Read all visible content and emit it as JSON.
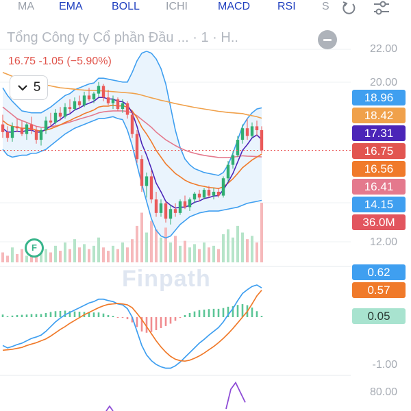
{
  "toolbar": {
    "tabs": [
      {
        "label": "MA",
        "active": false
      },
      {
        "label": "EMA",
        "active": true
      },
      {
        "label": "BOLL",
        "active": true
      },
      {
        "label": "ICHI",
        "active": false
      },
      {
        "label": "MACD",
        "active": true
      },
      {
        "label": "RSI",
        "active": true
      },
      {
        "label": "S",
        "active": false
      }
    ],
    "icons": [
      "reset-icon",
      "settings-sliders-icon"
    ]
  },
  "header": {
    "title": "Tổng Công ty Cổ phần Đầu ...  · 1 · H..",
    "quote": "16.75  -1.05 (−5.90%)",
    "period": "5"
  },
  "price_axis": {
    "labels": [
      "22.00",
      "20.00",
      "12.00"
    ]
  },
  "price_badges": [
    {
      "label": "18.96",
      "color": "#3f9ff0"
    },
    {
      "label": "18.42",
      "color": "#f0a14b"
    },
    {
      "label": "17.31",
      "color": "#4b25b8"
    },
    {
      "label": "16.75",
      "color": "#e25550"
    },
    {
      "label": "16.56",
      "color": "#f07a2a"
    },
    {
      "label": "16.41",
      "color": "#e4798d"
    },
    {
      "label": "14.15",
      "color": "#3f9ff0"
    },
    {
      "label": "36.0M",
      "color": "#e2555e"
    }
  ],
  "macd_axis": {
    "labels": [
      "-1.00"
    ]
  },
  "macd_badges": [
    {
      "label": "0.62",
      "color": "#3f9ff0"
    },
    {
      "label": "0.57",
      "color": "#f07a2a"
    },
    {
      "label": "0.05",
      "color": "#a8e3cf",
      "text": "#2a3a33"
    }
  ],
  "rsi_axis": {
    "labels": [
      "80.00"
    ]
  },
  "watermark": "Finpath",
  "logo_text": "F",
  "colors": {
    "up": "#2fae72",
    "down": "#ea5a5a",
    "boll": "#3f9ff0",
    "ema_slow": "#f0a14b",
    "ema_mid": "#4b25b8",
    "ema_fast": "#f07a2a",
    "ema_pink": "#e4798d",
    "macd_line": "#3f9ff0",
    "signal_line": "#f07a2a",
    "rsi": "#8e4cd6"
  },
  "chart_data": {
    "type": "line",
    "candles": [
      {
        "o": 18.1,
        "h": 18.6,
        "l": 17.4,
        "c": 17.7
      },
      {
        "o": 17.7,
        "h": 18.0,
        "l": 17.2,
        "c": 17.4
      },
      {
        "o": 17.4,
        "h": 18.2,
        "l": 17.2,
        "c": 18.0
      },
      {
        "o": 18.0,
        "h": 18.4,
        "l": 17.7,
        "c": 17.9
      },
      {
        "o": 17.9,
        "h": 18.3,
        "l": 17.5,
        "c": 17.6
      },
      {
        "o": 17.6,
        "h": 18.2,
        "l": 17.3,
        "c": 18.1
      },
      {
        "o": 18.1,
        "h": 18.5,
        "l": 17.6,
        "c": 17.8
      },
      {
        "o": 17.8,
        "h": 18.0,
        "l": 17.1,
        "c": 17.3
      },
      {
        "o": 17.3,
        "h": 17.9,
        "l": 17.0,
        "c": 17.8
      },
      {
        "o": 17.8,
        "h": 18.5,
        "l": 17.6,
        "c": 18.3
      },
      {
        "o": 18.3,
        "h": 18.7,
        "l": 18.0,
        "c": 18.2
      },
      {
        "o": 18.2,
        "h": 18.9,
        "l": 18.1,
        "c": 18.7
      },
      {
        "o": 18.7,
        "h": 19.0,
        "l": 18.3,
        "c": 18.5
      },
      {
        "o": 18.5,
        "h": 19.2,
        "l": 18.4,
        "c": 19.0
      },
      {
        "o": 19.0,
        "h": 19.4,
        "l": 18.7,
        "c": 18.9
      },
      {
        "o": 18.9,
        "h": 19.5,
        "l": 18.8,
        "c": 19.3
      },
      {
        "o": 19.3,
        "h": 19.6,
        "l": 18.9,
        "c": 19.1
      },
      {
        "o": 19.1,
        "h": 19.8,
        "l": 19.0,
        "c": 19.6
      },
      {
        "o": 19.6,
        "h": 20.0,
        "l": 19.3,
        "c": 19.4
      },
      {
        "o": 19.4,
        "h": 19.8,
        "l": 19.2,
        "c": 19.7
      },
      {
        "o": 19.7,
        "h": 20.3,
        "l": 19.5,
        "c": 20.1
      },
      {
        "o": 20.1,
        "h": 20.2,
        "l": 19.3,
        "c": 19.5
      },
      {
        "o": 19.5,
        "h": 19.9,
        "l": 19.1,
        "c": 19.2
      },
      {
        "o": 19.2,
        "h": 19.6,
        "l": 18.9,
        "c": 19.4
      },
      {
        "o": 19.4,
        "h": 19.5,
        "l": 18.8,
        "c": 18.9
      },
      {
        "o": 18.9,
        "h": 19.4,
        "l": 18.7,
        "c": 19.2
      },
      {
        "o": 19.2,
        "h": 19.3,
        "l": 18.4,
        "c": 18.6
      },
      {
        "o": 18.6,
        "h": 18.8,
        "l": 17.4,
        "c": 17.6
      },
      {
        "o": 17.6,
        "h": 17.8,
        "l": 16.1,
        "c": 16.3
      },
      {
        "o": 16.3,
        "h": 16.5,
        "l": 14.6,
        "c": 14.9
      },
      {
        "o": 14.9,
        "h": 15.6,
        "l": 14.3,
        "c": 15.4
      },
      {
        "o": 15.4,
        "h": 15.7,
        "l": 14.0,
        "c": 14.2
      },
      {
        "o": 14.2,
        "h": 14.6,
        "l": 13.3,
        "c": 13.5
      },
      {
        "o": 13.5,
        "h": 14.2,
        "l": 13.3,
        "c": 14.0
      },
      {
        "o": 14.0,
        "h": 14.1,
        "l": 13.0,
        "c": 13.2
      },
      {
        "o": 13.2,
        "h": 13.9,
        "l": 12.9,
        "c": 13.7
      },
      {
        "o": 13.7,
        "h": 14.0,
        "l": 13.3,
        "c": 13.5
      },
      {
        "o": 13.5,
        "h": 14.2,
        "l": 13.4,
        "c": 14.1
      },
      {
        "o": 14.1,
        "h": 14.4,
        "l": 13.7,
        "c": 13.8
      },
      {
        "o": 13.8,
        "h": 14.3,
        "l": 13.6,
        "c": 14.2
      },
      {
        "o": 14.2,
        "h": 14.6,
        "l": 14.0,
        "c": 14.5
      },
      {
        "o": 14.5,
        "h": 14.7,
        "l": 14.1,
        "c": 14.3
      },
      {
        "o": 14.3,
        "h": 14.8,
        "l": 14.2,
        "c": 14.7
      },
      {
        "o": 14.7,
        "h": 14.9,
        "l": 14.3,
        "c": 14.4
      },
      {
        "o": 14.4,
        "h": 14.8,
        "l": 14.2,
        "c": 14.6
      },
      {
        "o": 14.6,
        "h": 14.8,
        "l": 14.3,
        "c": 14.4
      },
      {
        "o": 14.4,
        "h": 15.4,
        "l": 14.3,
        "c": 15.3
      },
      {
        "o": 15.3,
        "h": 16.2,
        "l": 15.1,
        "c": 16.0
      },
      {
        "o": 16.0,
        "h": 16.7,
        "l": 15.8,
        "c": 16.5
      },
      {
        "o": 16.5,
        "h": 17.5,
        "l": 16.4,
        "c": 17.3
      },
      {
        "o": 17.3,
        "h": 18.1,
        "l": 17.1,
        "c": 17.9
      },
      {
        "o": 17.9,
        "h": 18.4,
        "l": 17.3,
        "c": 17.5
      },
      {
        "o": 17.5,
        "h": 18.2,
        "l": 17.4,
        "c": 18.0
      },
      {
        "o": 18.0,
        "h": 18.3,
        "l": 17.5,
        "c": 17.8
      },
      {
        "o": 17.8,
        "h": 18.0,
        "l": 16.6,
        "c": 16.75
      }
    ],
    "volume_scale": 36.0,
    "volumes": [
      6,
      4,
      9,
      5,
      8,
      4,
      7,
      6,
      11,
      8,
      6,
      10,
      7,
      12,
      8,
      14,
      9,
      11,
      8,
      10,
      15,
      9,
      7,
      10,
      8,
      12,
      9,
      14,
      22,
      30,
      18,
      25,
      20,
      15,
      21,
      12,
      16,
      10,
      13,
      9,
      11,
      8,
      12,
      9,
      10,
      8,
      17,
      20,
      15,
      22,
      18,
      14,
      16,
      12,
      36
    ],
    "ema_slow": [
      20.8,
      20.7,
      20.6,
      20.5,
      20.45,
      20.4,
      20.3,
      20.25,
      20.2,
      20.15,
      20.1,
      20.05,
      20.0,
      19.98,
      19.95,
      19.93,
      19.9,
      19.88,
      19.87,
      19.86,
      19.85,
      19.84,
      19.82,
      19.8,
      19.78,
      19.76,
      19.74,
      19.72,
      19.68,
      19.62,
      19.55,
      19.48,
      19.42,
      19.35,
      19.3,
      19.24,
      19.18,
      19.13,
      19.08,
      19.03,
      18.98,
      18.94,
      18.9,
      18.86,
      18.82,
      18.78,
      18.75,
      18.72,
      18.7,
      18.68,
      18.66,
      18.6,
      18.55,
      18.5,
      18.42
    ],
    "ema_pink": [
      19.0,
      18.8,
      18.6,
      18.4,
      18.3,
      18.2,
      18.1,
      18.0,
      17.95,
      17.95,
      17.98,
      18.02,
      18.08,
      18.15,
      18.22,
      18.3,
      18.38,
      18.45,
      18.52,
      18.6,
      18.7,
      18.75,
      18.78,
      18.8,
      18.8,
      18.8,
      18.78,
      18.7,
      18.55,
      18.35,
      18.15,
      17.95,
      17.7,
      17.5,
      17.3,
      17.15,
      17.0,
      16.87,
      16.76,
      16.67,
      16.6,
      16.54,
      16.49,
      16.45,
      16.42,
      16.38,
      16.37,
      16.38,
      16.4,
      16.43,
      16.47,
      16.45,
      16.44,
      16.43,
      16.41
    ],
    "ema_fast": [
      18.3,
      18.1,
      18.0,
      17.95,
      17.9,
      17.9,
      17.88,
      17.8,
      17.75,
      17.8,
      17.87,
      17.97,
      18.07,
      18.2,
      18.3,
      18.43,
      18.53,
      18.66,
      18.75,
      18.85,
      19.0,
      19.05,
      19.05,
      19.1,
      19.05,
      19.07,
      19.0,
      18.8,
      18.45,
      17.95,
      17.6,
      17.2,
      16.75,
      16.4,
      16.05,
      15.8,
      15.55,
      15.38,
      15.2,
      15.08,
      15.0,
      14.92,
      14.88,
      14.82,
      14.8,
      14.77,
      14.85,
      15.05,
      15.27,
      15.55,
      15.85,
      16.05,
      16.25,
      16.4,
      16.56
    ],
    "ema_mid": [
      17.9,
      17.7,
      17.7,
      17.75,
      17.7,
      17.8,
      17.8,
      17.7,
      17.7,
      17.85,
      18.0,
      18.2,
      18.35,
      18.55,
      18.65,
      18.85,
      18.95,
      19.1,
      19.2,
      19.3,
      19.5,
      19.5,
      19.42,
      19.42,
      19.3,
      19.28,
      19.1,
      18.7,
      18.0,
      17.1,
      16.5,
      15.8,
      15.05,
      14.6,
      14.1,
      13.9,
      13.75,
      13.8,
      13.8,
      13.9,
      14.05,
      14.12,
      14.25,
      14.3,
      14.38,
      14.4,
      14.7,
      15.1,
      15.55,
      16.15,
      16.75,
      17.05,
      17.4,
      17.55,
      17.31
    ],
    "boll_upper": [
      20.0,
      19.6,
      19.3,
      19.05,
      18.8,
      18.75,
      18.7,
      18.7,
      18.7,
      18.85,
      19.0,
      19.2,
      19.4,
      19.6,
      19.7,
      19.9,
      20.0,
      20.1,
      20.2,
      20.25,
      20.5,
      20.5,
      20.45,
      20.4,
      20.35,
      20.3,
      20.3,
      20.8,
      21.4,
      21.8,
      21.9,
      21.8,
      21.5,
      21.0,
      20.2,
      19.0,
      17.8,
      16.9,
      16.3,
      16.0,
      15.8,
      15.7,
      15.6,
      15.55,
      15.5,
      15.45,
      15.6,
      16.0,
      16.6,
      17.3,
      18.0,
      18.4,
      18.7,
      18.9,
      18.96
    ],
    "boll_lower": [
      16.8,
      16.5,
      16.4,
      16.45,
      16.5,
      16.5,
      16.6,
      16.6,
      16.7,
      16.8,
      17.0,
      17.2,
      17.4,
      17.6,
      17.75,
      17.9,
      18.0,
      18.1,
      18.2,
      18.3,
      18.4,
      18.4,
      18.45,
      18.5,
      18.4,
      18.35,
      17.8,
      17.0,
      16.0,
      15.0,
      14.1,
      13.2,
      12.6,
      12.3,
      12.2,
      12.3,
      12.6,
      12.9,
      13.1,
      13.3,
      13.4,
      13.5,
      13.55,
      13.6,
      13.6,
      13.6,
      13.65,
      13.7,
      13.75,
      13.8,
      13.9,
      14.0,
      14.05,
      14.1,
      14.15
    ],
    "macd": [
      -0.6,
      -0.65,
      -0.62,
      -0.58,
      -0.55,
      -0.5,
      -0.45,
      -0.42,
      -0.38,
      -0.3,
      -0.2,
      -0.1,
      -0.02,
      0.05,
      0.1,
      0.15,
      0.2,
      0.25,
      0.3,
      0.33,
      0.38,
      0.38,
      0.35,
      0.33,
      0.28,
      0.26,
      0.18,
      0.0,
      -0.3,
      -0.6,
      -0.8,
      -0.92,
      -1.0,
      -1.05,
      -1.08,
      -1.08,
      -1.03,
      -0.95,
      -0.85,
      -0.75,
      -0.65,
      -0.55,
      -0.47,
      -0.38,
      -0.3,
      -0.22,
      -0.1,
      0.05,
      0.18,
      0.35,
      0.5,
      0.58,
      0.65,
      0.68,
      0.62
    ],
    "signal": [
      -0.7,
      -0.69,
      -0.68,
      -0.66,
      -0.64,
      -0.6,
      -0.57,
      -0.54,
      -0.5,
      -0.46,
      -0.4,
      -0.33,
      -0.26,
      -0.2,
      -0.13,
      -0.07,
      -0.01,
      0.05,
      0.1,
      0.15,
      0.2,
      0.24,
      0.27,
      0.28,
      0.29,
      0.28,
      0.26,
      0.2,
      0.08,
      -0.05,
      -0.2,
      -0.35,
      -0.5,
      -0.63,
      -0.74,
      -0.83,
      -0.89,
      -0.92,
      -0.93,
      -0.91,
      -0.87,
      -0.82,
      -0.76,
      -0.69,
      -0.62,
      -0.54,
      -0.45,
      -0.35,
      -0.24,
      -0.12,
      0.0,
      0.12,
      0.28,
      0.45,
      0.57
    ],
    "rsi_tail": [
      70,
      82,
      86,
      80,
      74
    ]
  }
}
